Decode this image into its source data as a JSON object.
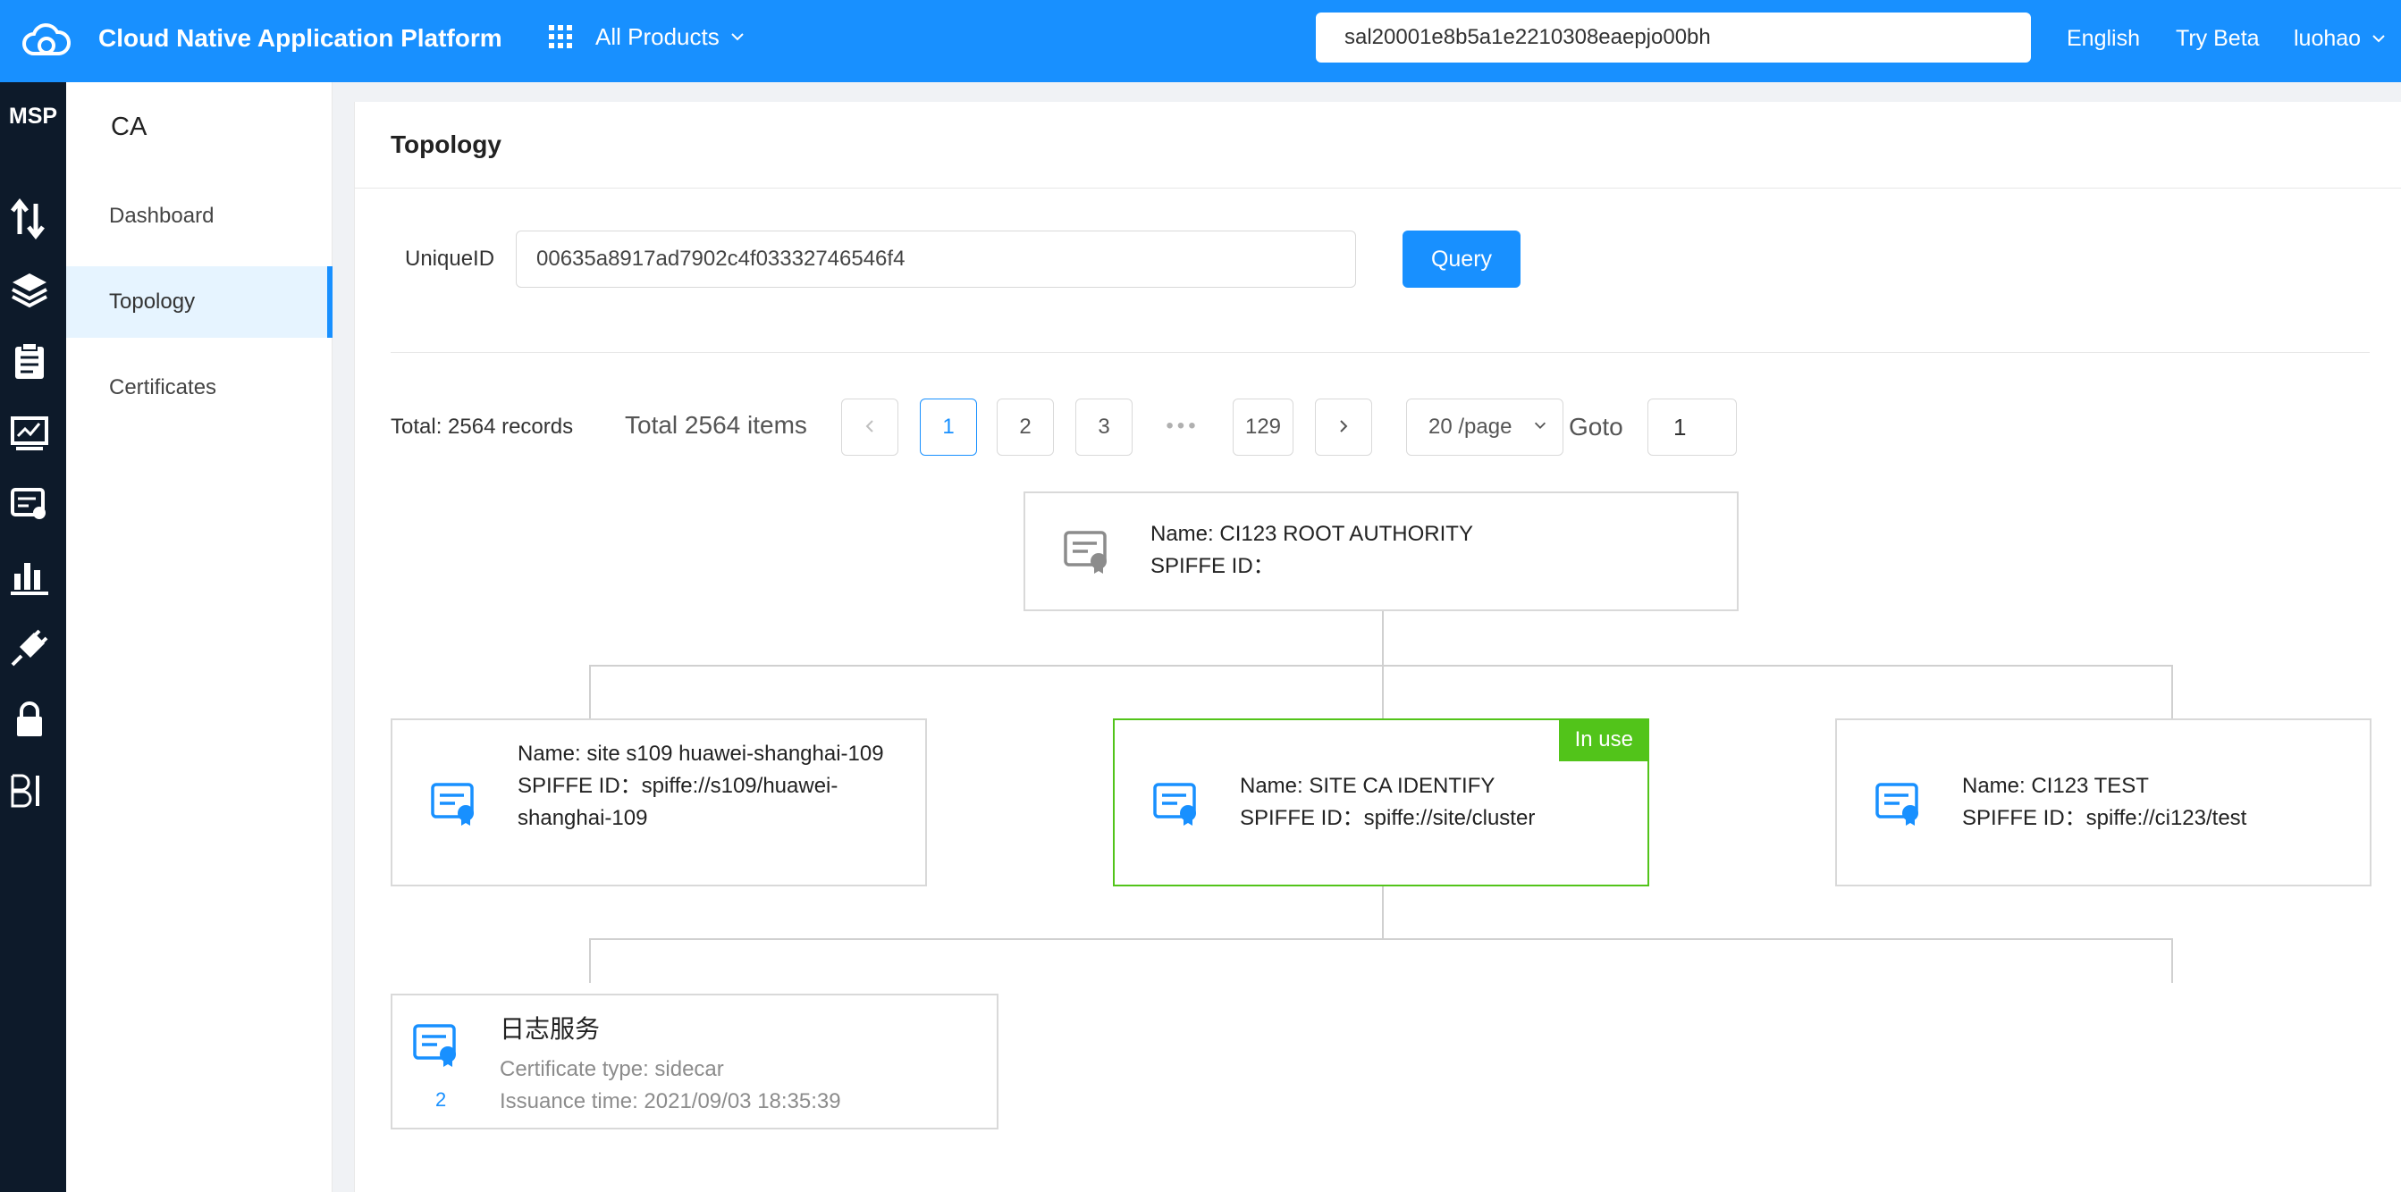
{
  "header": {
    "app_title": "Cloud Native Application Platform",
    "products_label": "All Products",
    "search_value": "sal20001e8b5a1e2210308eaepjo00bh",
    "language": "English",
    "try_beta": "Try Beta",
    "user": "luohao",
    "accent_color": "#1890ff"
  },
  "rail": {
    "label": "MSP",
    "icons": [
      "transfer-icon",
      "layers-icon",
      "clipboard-icon",
      "monitor-chart-icon",
      "certificate-monitor-icon",
      "bar-chart-icon",
      "plug-icon",
      "lock-icon",
      "bi-icon"
    ]
  },
  "sidebar": {
    "section": "CA",
    "items": [
      {
        "label": "Dashboard"
      },
      {
        "label": "Topology"
      },
      {
        "label": "Certificates"
      }
    ],
    "active_item": "Topology"
  },
  "main": {
    "title": "Topology",
    "unique_id_label": "UniqueID",
    "unique_id_value": "00635a8917ad7902c4f03332746546f4",
    "query_label": "Query"
  },
  "pagination": {
    "total_records": "Total: 2564 records",
    "total_items": "Total 2564 items",
    "pages": [
      "1",
      "2",
      "3",
      "•••",
      "129"
    ],
    "current_page": "1",
    "page_size": "20 /page",
    "goto_label": "Goto",
    "goto_value": "1"
  },
  "tree": {
    "root": {
      "name": "Name: CI123 ROOT AUTHORITY",
      "spiffe": "SPIFFE ID："
    },
    "children": [
      {
        "name": "Name: site s109 huawei-shanghai-109",
        "spiffe": "SPIFFE ID：spiffe://s109/huawei-shanghai-109"
      },
      {
        "name": "Name: SITE CA IDENTIFY",
        "spiffe": "SPIFFE ID：spiffe://site/cluster",
        "badge": "In use"
      },
      {
        "name": "Name: CI123 TEST",
        "spiffe": "SPIFFE ID：spiffe://ci123/test"
      }
    ],
    "leaf": {
      "title": "日志服务",
      "type": "Certificate type: sidecar",
      "time": "Issuance time: 2021/09/03 18:35:39",
      "count": "2"
    },
    "in_use_color": "#52c41a"
  }
}
